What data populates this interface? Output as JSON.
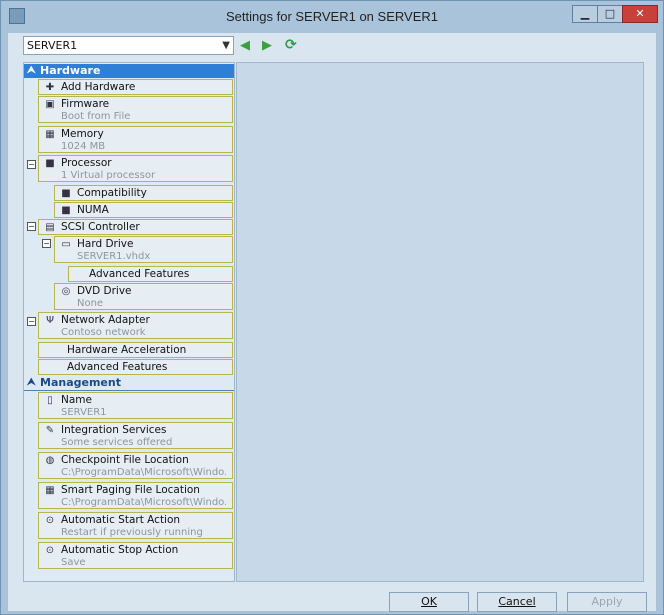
{
  "window": {
    "title": "Settings for SERVER1 on SERVER1",
    "minimize_glyph": "▁",
    "maximize_glyph": "□",
    "close_glyph": "✕"
  },
  "toolbar": {
    "server_selector": "SERVER1",
    "back_glyph": "◀",
    "forward_glyph": "▶",
    "refresh_glyph": "⟳"
  },
  "sections": {
    "hardware": {
      "label": "Hardware"
    },
    "management": {
      "label": "Management"
    }
  },
  "hardware_items": [
    {
      "label": "Add Hardware",
      "sub": ""
    },
    {
      "label": "Firmware",
      "sub": "Boot from File"
    },
    {
      "label": "Memory",
      "sub": "1024 MB"
    },
    {
      "label": "Processor",
      "sub": "1 Virtual processor"
    },
    {
      "label": "Compatibility",
      "sub": ""
    },
    {
      "label": "NUMA",
      "sub": ""
    },
    {
      "label": "SCSI Controller",
      "sub": ""
    },
    {
      "label": "Hard Drive",
      "sub": "SERVER1.vhdx"
    },
    {
      "label": "Advanced Features",
      "sub": ""
    },
    {
      "label": "DVD Drive",
      "sub": "None"
    },
    {
      "label": "Network Adapter",
      "sub": "Contoso network"
    },
    {
      "label": "Hardware Acceleration",
      "sub": ""
    },
    {
      "label": "Advanced Features",
      "sub": ""
    }
  ],
  "management_items": [
    {
      "label": "Name",
      "sub": "SERVER1"
    },
    {
      "label": "Integration Services",
      "sub": "Some services offered"
    },
    {
      "label": "Checkpoint File Location",
      "sub": "C:\\ProgramData\\Microsoft\\Windo..."
    },
    {
      "label": "Smart Paging File Location",
      "sub": "C:\\ProgramData\\Microsoft\\Windo..."
    },
    {
      "label": "Automatic Start Action",
      "sub": "Restart if previously running"
    },
    {
      "label": "Automatic Stop Action",
      "sub": "Save"
    }
  ],
  "buttons": {
    "ok": "OK",
    "cancel": "Cancel",
    "apply": "Apply"
  },
  "colors": {
    "selected_header": "#2f7fd6",
    "item_border": "#b9b54c",
    "close_button": "#c7403a"
  }
}
